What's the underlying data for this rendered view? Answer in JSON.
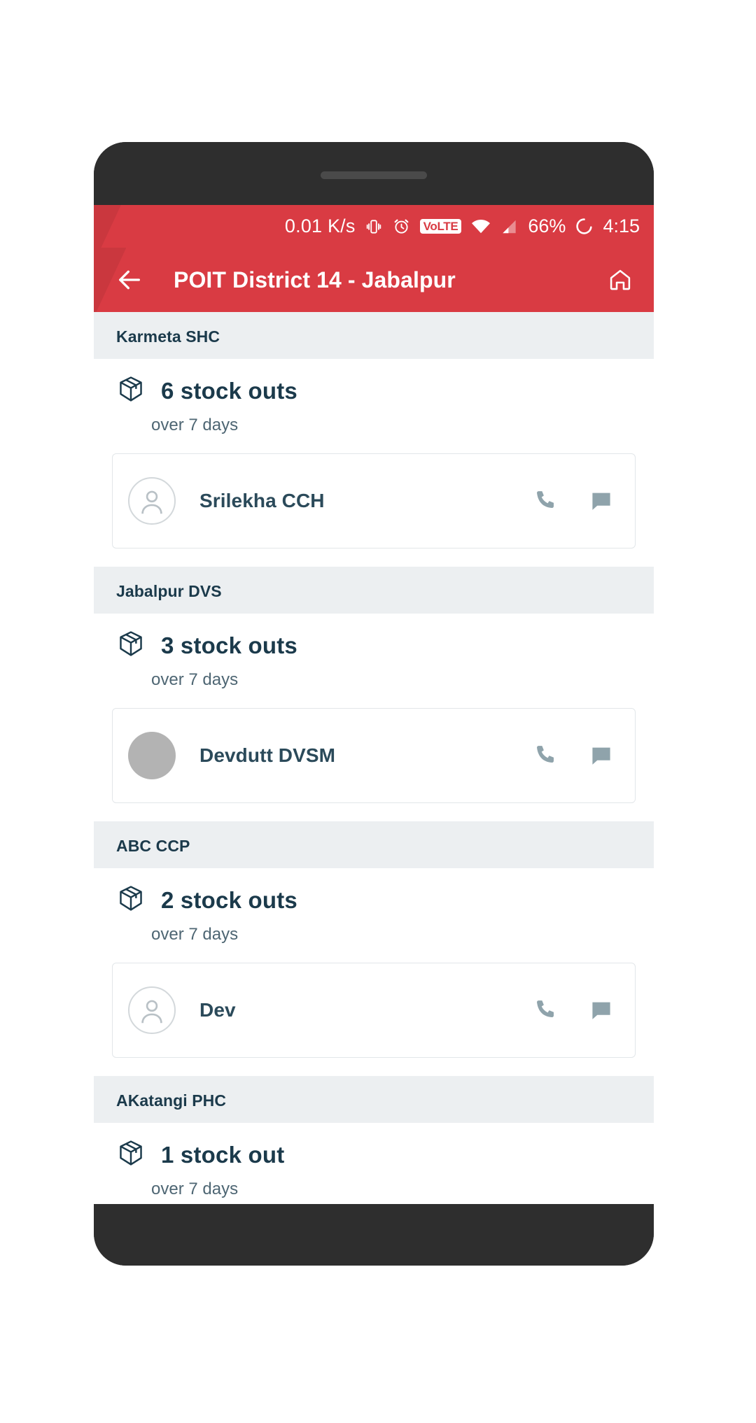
{
  "theme": {
    "accent_red": "#d93b43",
    "text_dark": "#1b3a4b",
    "icon_grey_blue": "#8fa3ab",
    "page_bg": "#eceff1"
  },
  "status_bar": {
    "network_speed": "0.01 K/s",
    "vibrate_icon": "vibrate-icon",
    "alarm_icon": "alarm-icon",
    "volte_label": "VoLTE",
    "wifi_icon": "wifi-icon",
    "signal_icon": "cellular-signal-icon",
    "battery_percent": "66%",
    "battery_icon": "battery-circle-icon",
    "clock": "4:15"
  },
  "app_bar": {
    "back_icon": "arrow-left-icon",
    "title": "POIT District 14 - Jabalpur",
    "home_icon": "home-icon"
  },
  "groups": [
    {
      "facility": "Karmeta SHC",
      "stock_icon": "package-box-icon",
      "stock_title": "6 stock outs",
      "stock_sub": "over 7 days",
      "contacts": [
        {
          "name": "Srilekha CCH",
          "avatar_style": "outline",
          "avatar_icon": "person-avatar-icon",
          "call_icon": "phone-icon",
          "message_icon": "chat-bubble-icon"
        }
      ]
    },
    {
      "facility": "Jabalpur DVS",
      "stock_icon": "package-box-icon",
      "stock_title": "3 stock outs",
      "stock_sub": "over 7 days",
      "contacts": [
        {
          "name": "Devdutt DVSM",
          "avatar_style": "filled",
          "avatar_icon": "person-avatar-icon",
          "call_icon": "phone-icon",
          "message_icon": "chat-bubble-icon"
        }
      ]
    },
    {
      "facility": "ABC CCP",
      "stock_icon": "package-box-icon",
      "stock_title": "2 stock outs",
      "stock_sub": "over 7 days",
      "contacts": [
        {
          "name": "Dev",
          "avatar_style": "outline",
          "avatar_icon": "person-avatar-icon",
          "call_icon": "phone-icon",
          "message_icon": "chat-bubble-icon"
        }
      ]
    },
    {
      "facility": "AKatangi PHC",
      "stock_icon": "package-box-icon",
      "stock_title": "1 stock out",
      "stock_sub": "over 7 days",
      "contacts": []
    }
  ]
}
